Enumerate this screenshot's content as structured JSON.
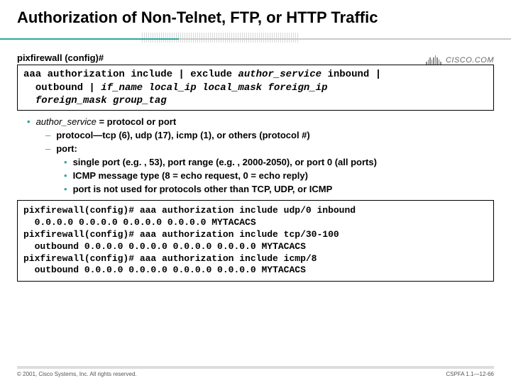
{
  "title": "Authorization of Non-Telnet, FTP, or HTTP Traffic",
  "logo_text": "CISCO.COM",
  "prompt_label": "pixfirewall (config)#",
  "syntax": "aaa authorization include | exclude author_service inbound |\n  outbound | if_name local_ip local_mask foreign_ip\n  foreign_mask group_tag",
  "bullets": {
    "l1": "author_service = protocol or port",
    "l2a": "protocol—tcp (6), udp (17), icmp (1), or others (protocol #)",
    "l2b": "port:",
    "l3a": "single port (e.g. , 53), port range (e.g. , 2000-2050), or port 0 (all ports)",
    "l3b": "ICMP message type (8 = echo request, 0 = echo reply)",
    "l3c": "port is not used for protocols other than TCP, UDP, or ICMP"
  },
  "example": "pixfirewall(config)# aaa authorization include udp/0 inbound\n  0.0.0.0 0.0.0.0 0.0.0.0 0.0.0.0 MYTACACS\npixfirewall(config)# aaa authorization include tcp/30-100\n  outbound 0.0.0.0 0.0.0.0 0.0.0.0 0.0.0.0 MYTACACS\npixfirewall(config)# aaa authorization include icmp/8\n  outbound 0.0.0.0 0.0.0.0 0.0.0.0 0.0.0.0 MYTACACS",
  "footer_left": "© 2001, Cisco Systems, Inc. All rights reserved.",
  "footer_right": "CSPFA 1.1—12-66"
}
